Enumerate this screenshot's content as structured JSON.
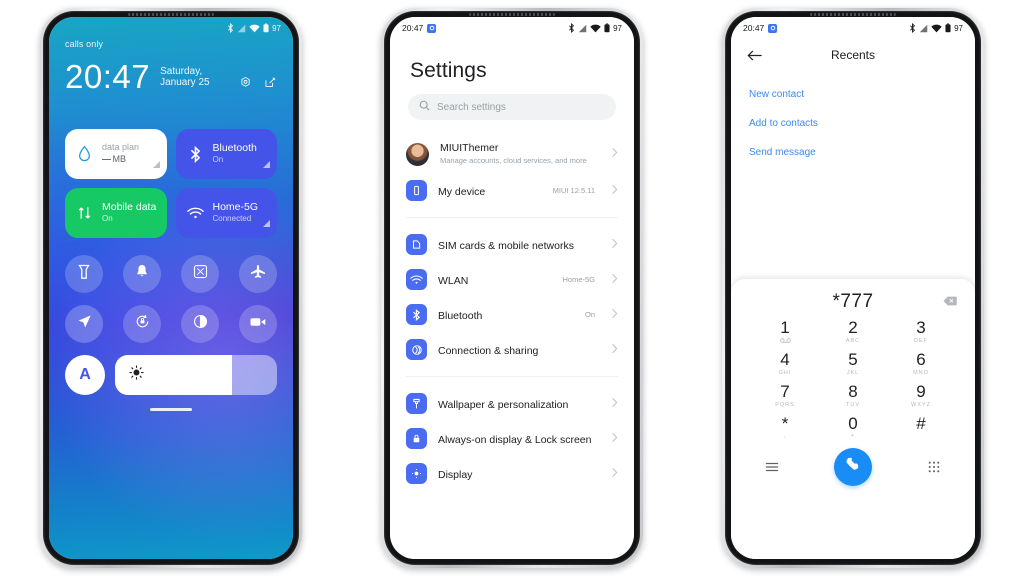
{
  "statusbar": {
    "time": "20:47",
    "battery_percent": "97",
    "icons": [
      "bluetooth-icon",
      "signal-icon",
      "wifi-icon",
      "battery-icon"
    ],
    "badge_icon": "app-badge-icon"
  },
  "phone1": {
    "name": "control-center",
    "carrier": "calls only",
    "clock": "20:47",
    "date": "Saturday, January 25",
    "top_icons": [
      "settings-gear-icon",
      "edit-icon"
    ],
    "tiles": [
      {
        "name": "data-plan",
        "title": "data plan",
        "sub": "MB",
        "value_dash": "—",
        "icon": "water-drop-icon",
        "style": "white"
      },
      {
        "name": "bluetooth",
        "title": "Bluetooth",
        "sub": "On",
        "icon": "bluetooth-icon",
        "style": "blue"
      },
      {
        "name": "mobile-data",
        "title": "Mobile data",
        "sub": "On",
        "icon": "mobile-data-icon",
        "style": "green"
      },
      {
        "name": "wifi",
        "title": "Home-5G",
        "sub": "Connected",
        "icon": "wifi-icon",
        "style": "blue"
      }
    ],
    "toggles": [
      {
        "name": "flashlight",
        "icon": "flashlight-icon"
      },
      {
        "name": "ringer",
        "icon": "bell-icon"
      },
      {
        "name": "screenshot",
        "icon": "screenshot-icon"
      },
      {
        "name": "airplane-mode",
        "icon": "airplane-icon"
      },
      {
        "name": "location",
        "icon": "location-arrow-icon"
      },
      {
        "name": "auto-rotate",
        "icon": "rotate-lock-icon"
      },
      {
        "name": "dark-mode",
        "icon": "contrast-icon"
      },
      {
        "name": "screen-recorder",
        "icon": "video-camera-icon"
      }
    ],
    "brightness": {
      "auto_label": "A",
      "icon": "brightness-sun-icon",
      "fill_percent": 72
    }
  },
  "phone2": {
    "name": "settings",
    "title": "Settings",
    "search_placeholder": "Search settings",
    "search_value": "",
    "search_icon": "search-icon",
    "groups": [
      {
        "rows": [
          {
            "label": "MIUIThemer",
            "desc": "Manage accounts, cloud services, and more",
            "value": "",
            "icon": "account-avatar",
            "type": "account"
          },
          {
            "label": "My device",
            "desc": "",
            "value": "MIUI 12.5.11",
            "icon": "phone-device-icon",
            "type": "item"
          }
        ]
      },
      {
        "rows": [
          {
            "label": "SIM cards & mobile networks",
            "desc": "",
            "value": "",
            "icon": "sim-card-icon",
            "type": "item"
          },
          {
            "label": "WLAN",
            "desc": "",
            "value": "Home-5G",
            "icon": "wifi-icon",
            "type": "item"
          },
          {
            "label": "Bluetooth",
            "desc": "",
            "value": "On",
            "icon": "bluetooth-icon",
            "type": "item"
          },
          {
            "label": "Connection & sharing",
            "desc": "",
            "value": "",
            "icon": "connection-sharing-icon",
            "type": "item"
          }
        ]
      },
      {
        "rows": [
          {
            "label": "Wallpaper & personalization",
            "desc": "",
            "value": "",
            "icon": "paintbrush-icon",
            "type": "item"
          },
          {
            "label": "Always-on display & Lock screen",
            "desc": "",
            "value": "",
            "icon": "lock-icon",
            "type": "item"
          },
          {
            "label": "Display",
            "desc": "",
            "value": "",
            "icon": "display-icon",
            "type": "item"
          }
        ]
      }
    ]
  },
  "phone3": {
    "name": "dialer-recents",
    "title": "Recents",
    "back_icon": "arrow-left-icon",
    "actions": [
      "New contact",
      "Add to contacts",
      "Send message"
    ],
    "dialed_number": "*777",
    "delete_icon": "backspace-icon",
    "keys": [
      {
        "num": "1",
        "sub": "∞"
      },
      {
        "num": "2",
        "sub": "ABC"
      },
      {
        "num": "3",
        "sub": "DEF"
      },
      {
        "num": "4",
        "sub": "GHI"
      },
      {
        "num": "5",
        "sub": "JKL"
      },
      {
        "num": "6",
        "sub": "MNO"
      },
      {
        "num": "7",
        "sub": "PQRS"
      },
      {
        "num": "8",
        "sub": "TUV"
      },
      {
        "num": "9",
        "sub": "WXYZ"
      },
      {
        "num": "*",
        "sub": ","
      },
      {
        "num": "0",
        "sub": "+"
      },
      {
        "num": "#",
        "sub": ""
      }
    ],
    "bottom": {
      "menu_icon": "menu-lines-icon",
      "call_icon": "phone-call-icon",
      "keypad_icon": "keypad-dots-icon"
    }
  },
  "colors": {
    "accent_blue": "#4453e8",
    "green": "#17c964",
    "call_blue": "#1a8cf5",
    "link_blue": "#3b8bef",
    "settings_icon_blue": "#4a6cf0"
  }
}
